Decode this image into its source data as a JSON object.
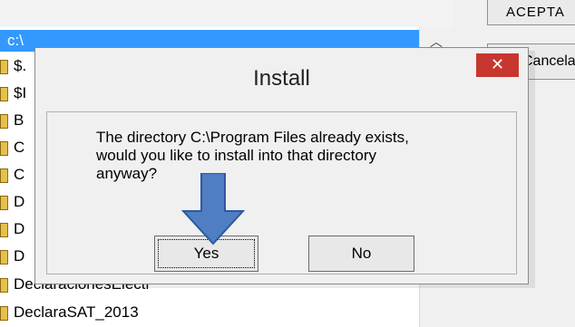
{
  "background": {
    "path_selected": "c:\\",
    "aceptar_label": "ACEPTA",
    "cancel_label": "Cancela",
    "rows": [
      {
        "label": "$."
      },
      {
        "label": "$I"
      },
      {
        "label": "B"
      },
      {
        "label": "C"
      },
      {
        "label": "C"
      },
      {
        "label": "D"
      },
      {
        "label": "D"
      },
      {
        "label": "D"
      },
      {
        "label": "DeclaracionesElectr"
      },
      {
        "label": "DeclaraSAT_2013"
      }
    ]
  },
  "dialog": {
    "title": "Install",
    "close_symbol": "✕",
    "message_line1": "The directory C:\\Program Files already exists,",
    "message_line2": "would you like to install into that directory",
    "message_line3": "anyway?",
    "yes_label": "Yes",
    "no_label": "No"
  },
  "colors": {
    "selection": "#3399ff",
    "close_button": "#c7372f",
    "arrow_fill": "#4f7ec2"
  },
  "icons": {
    "arrow": "down-arrow-annotation",
    "scroll": "scroll-up-arrow"
  }
}
